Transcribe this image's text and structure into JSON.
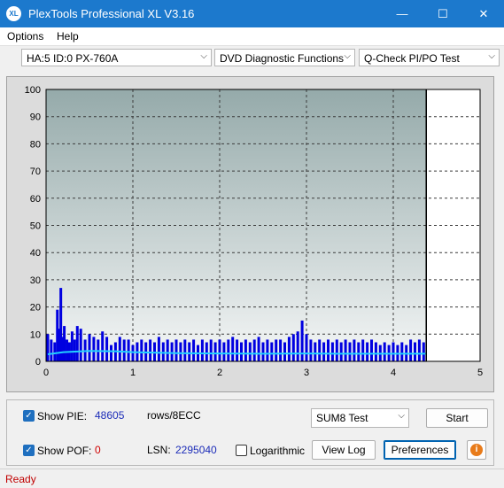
{
  "window": {
    "title": "PlexTools Professional XL V3.16",
    "icon_text": "XL",
    "minimize": "—",
    "maximize": "☐",
    "close": "✕"
  },
  "menu": {
    "options": "Options",
    "help": "Help"
  },
  "toolbar": {
    "drive": "HA:5 ID:0  PX-760A",
    "function": "DVD Diagnostic Functions",
    "test": "Q-Check PI/PO Test"
  },
  "chart_data": {
    "type": "bar",
    "xlim": [
      0,
      5
    ],
    "ylim": [
      0,
      100
    ],
    "x_ticks": [
      "0",
      "1",
      "2",
      "3",
      "4",
      "5"
    ],
    "y_ticks": [
      "0",
      "10",
      "20",
      "30",
      "40",
      "50",
      "60",
      "70",
      "80",
      "90",
      "100"
    ],
    "end_marker_x": 4.38,
    "grid": true,
    "colors": {
      "bars": "#0000e0",
      "average": "#22d0ff",
      "end_marker": "#000000"
    },
    "series": [
      {
        "values": [
          {
            "x": 0.02,
            "y": 10
          },
          {
            "x": 0.06,
            "y": 8
          },
          {
            "x": 0.1,
            "y": 7
          },
          {
            "x": 0.13,
            "y": 19
          },
          {
            "x": 0.15,
            "y": 12
          },
          {
            "x": 0.17,
            "y": 27
          },
          {
            "x": 0.19,
            "y": 9
          },
          {
            "x": 0.21,
            "y": 13
          },
          {
            "x": 0.24,
            "y": 8
          },
          {
            "x": 0.27,
            "y": 7
          },
          {
            "x": 0.3,
            "y": 11
          },
          {
            "x": 0.33,
            "y": 8
          },
          {
            "x": 0.36,
            "y": 13
          },
          {
            "x": 0.4,
            "y": 12
          },
          {
            "x": 0.45,
            "y": 8
          },
          {
            "x": 0.5,
            "y": 10
          },
          {
            "x": 0.55,
            "y": 9
          },
          {
            "x": 0.6,
            "y": 8
          },
          {
            "x": 0.65,
            "y": 11
          },
          {
            "x": 0.7,
            "y": 9
          },
          {
            "x": 0.75,
            "y": 6
          },
          {
            "x": 0.8,
            "y": 7
          },
          {
            "x": 0.85,
            "y": 9
          },
          {
            "x": 0.9,
            "y": 8
          },
          {
            "x": 0.95,
            "y": 8
          },
          {
            "x": 1.0,
            "y": 6
          },
          {
            "x": 1.05,
            "y": 7
          },
          {
            "x": 1.1,
            "y": 8
          },
          {
            "x": 1.15,
            "y": 7
          },
          {
            "x": 1.2,
            "y": 8
          },
          {
            "x": 1.25,
            "y": 7
          },
          {
            "x": 1.3,
            "y": 9
          },
          {
            "x": 1.35,
            "y": 7
          },
          {
            "x": 1.4,
            "y": 8
          },
          {
            "x": 1.45,
            "y": 7
          },
          {
            "x": 1.5,
            "y": 8
          },
          {
            "x": 1.55,
            "y": 7
          },
          {
            "x": 1.6,
            "y": 8
          },
          {
            "x": 1.65,
            "y": 7
          },
          {
            "x": 1.7,
            "y": 8
          },
          {
            "x": 1.75,
            "y": 6
          },
          {
            "x": 1.8,
            "y": 8
          },
          {
            "x": 1.85,
            "y": 7
          },
          {
            "x": 1.9,
            "y": 8
          },
          {
            "x": 1.95,
            "y": 7
          },
          {
            "x": 2.0,
            "y": 8
          },
          {
            "x": 2.05,
            "y": 7
          },
          {
            "x": 2.1,
            "y": 8
          },
          {
            "x": 2.15,
            "y": 9
          },
          {
            "x": 2.2,
            "y": 8
          },
          {
            "x": 2.25,
            "y": 7
          },
          {
            "x": 2.3,
            "y": 8
          },
          {
            "x": 2.35,
            "y": 7
          },
          {
            "x": 2.4,
            "y": 8
          },
          {
            "x": 2.45,
            "y": 9
          },
          {
            "x": 2.5,
            "y": 7
          },
          {
            "x": 2.55,
            "y": 8
          },
          {
            "x": 2.6,
            "y": 7
          },
          {
            "x": 2.65,
            "y": 8
          },
          {
            "x": 2.7,
            "y": 8
          },
          {
            "x": 2.75,
            "y": 7
          },
          {
            "x": 2.8,
            "y": 9
          },
          {
            "x": 2.85,
            "y": 10
          },
          {
            "x": 2.9,
            "y": 11
          },
          {
            "x": 2.95,
            "y": 15
          },
          {
            "x": 3.0,
            "y": 10
          },
          {
            "x": 3.05,
            "y": 8
          },
          {
            "x": 3.1,
            "y": 7
          },
          {
            "x": 3.15,
            "y": 8
          },
          {
            "x": 3.2,
            "y": 7
          },
          {
            "x": 3.25,
            "y": 8
          },
          {
            "x": 3.3,
            "y": 7
          },
          {
            "x": 3.35,
            "y": 8
          },
          {
            "x": 3.4,
            "y": 7
          },
          {
            "x": 3.45,
            "y": 8
          },
          {
            "x": 3.5,
            "y": 7
          },
          {
            "x": 3.55,
            "y": 8
          },
          {
            "x": 3.6,
            "y": 7
          },
          {
            "x": 3.65,
            "y": 8
          },
          {
            "x": 3.7,
            "y": 7
          },
          {
            "x": 3.75,
            "y": 8
          },
          {
            "x": 3.8,
            "y": 7
          },
          {
            "x": 3.85,
            "y": 6
          },
          {
            "x": 3.9,
            "y": 7
          },
          {
            "x": 3.95,
            "y": 6
          },
          {
            "x": 4.0,
            "y": 7
          },
          {
            "x": 4.05,
            "y": 6
          },
          {
            "x": 4.1,
            "y": 7
          },
          {
            "x": 4.15,
            "y": 6
          },
          {
            "x": 4.2,
            "y": 8
          },
          {
            "x": 4.25,
            "y": 7
          },
          {
            "x": 4.3,
            "y": 8
          },
          {
            "x": 4.35,
            "y": 7
          }
        ]
      },
      {
        "type": "line",
        "values": [
          {
            "x": 0.02,
            "y": 2.6
          },
          {
            "x": 0.2,
            "y": 3.4
          },
          {
            "x": 0.5,
            "y": 3.8
          },
          {
            "x": 0.8,
            "y": 3.7
          },
          {
            "x": 1.0,
            "y": 3.4
          },
          {
            "x": 1.5,
            "y": 3.0
          },
          {
            "x": 2.0,
            "y": 2.9
          },
          {
            "x": 2.5,
            "y": 2.8
          },
          {
            "x": 3.0,
            "y": 2.9
          },
          {
            "x": 3.5,
            "y": 2.8
          },
          {
            "x": 4.0,
            "y": 2.8
          },
          {
            "x": 4.38,
            "y": 2.8
          }
        ]
      }
    ]
  },
  "controls": {
    "show_pie_label": "Show PIE:",
    "pie_value": "48605",
    "pie_unit": "rows/8ECC",
    "show_pof_label": "Show POF:",
    "pof_value": "0",
    "lsn_label": "LSN:",
    "lsn_value": "2295040",
    "logarithmic_label": "Logarithmic",
    "test_select": "SUM8 Test",
    "start_button": "Start",
    "view_log_button": "View Log",
    "preferences_button": "Preferences",
    "info_icon": "i",
    "check_mark": "✓"
  },
  "status": {
    "text": "Ready"
  }
}
